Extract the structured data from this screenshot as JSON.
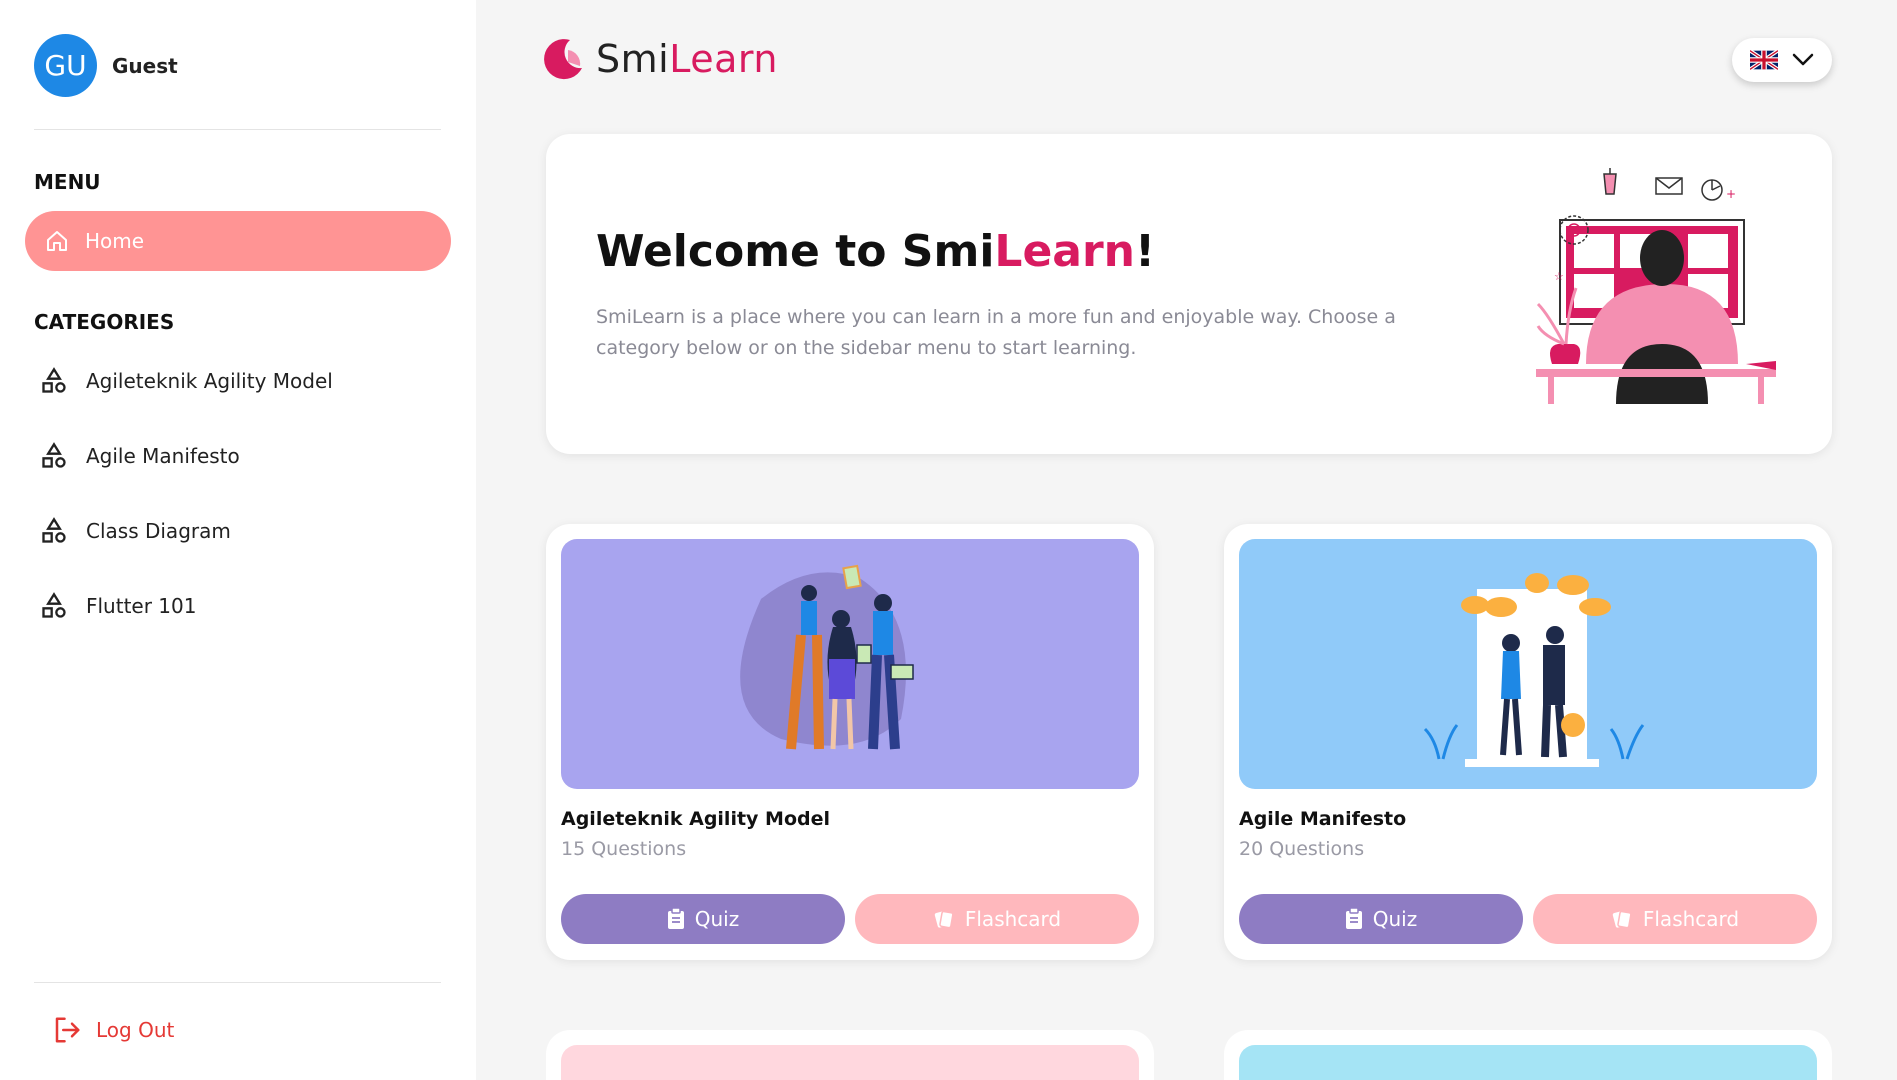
{
  "user": {
    "initials": "GU",
    "name": "Guest"
  },
  "sidebar": {
    "menu_heading": "MENU",
    "home_label": "Home",
    "categories_heading": "CATEGORIES",
    "categories": [
      {
        "label": "Agileteknik Agility Model"
      },
      {
        "label": "Agile Manifesto"
      },
      {
        "label": "Class Diagram"
      },
      {
        "label": "Flutter 101"
      }
    ],
    "logout_label": "Log Out"
  },
  "header": {
    "logo_main": "Smi",
    "logo_accent": "Learn",
    "language_flag": "uk-flag-icon"
  },
  "welcome": {
    "title_prefix": "Welcome to Smi",
    "title_accent": "Learn",
    "title_suffix": "!",
    "description": "SmiLearn is a place where you can learn in a more fun and enjoyable way. Choose a category below or on the sidebar menu to start learning."
  },
  "courses": [
    {
      "title": "Agileteknik Agility Model",
      "questions": "15 Questions",
      "quiz_label": "Quiz",
      "flashcard_label": "Flashcard",
      "image_color": "#a8a4ef"
    },
    {
      "title": "Agile Manifesto",
      "questions": "20 Questions",
      "quiz_label": "Quiz",
      "flashcard_label": "Flashcard",
      "image_color": "#90caf9"
    }
  ],
  "colors": {
    "accent": "#d81b60",
    "home_active": "#ff9494",
    "quiz": "#8e7cc3",
    "flashcard": "#ffb8bd",
    "logout": "#e53935"
  }
}
